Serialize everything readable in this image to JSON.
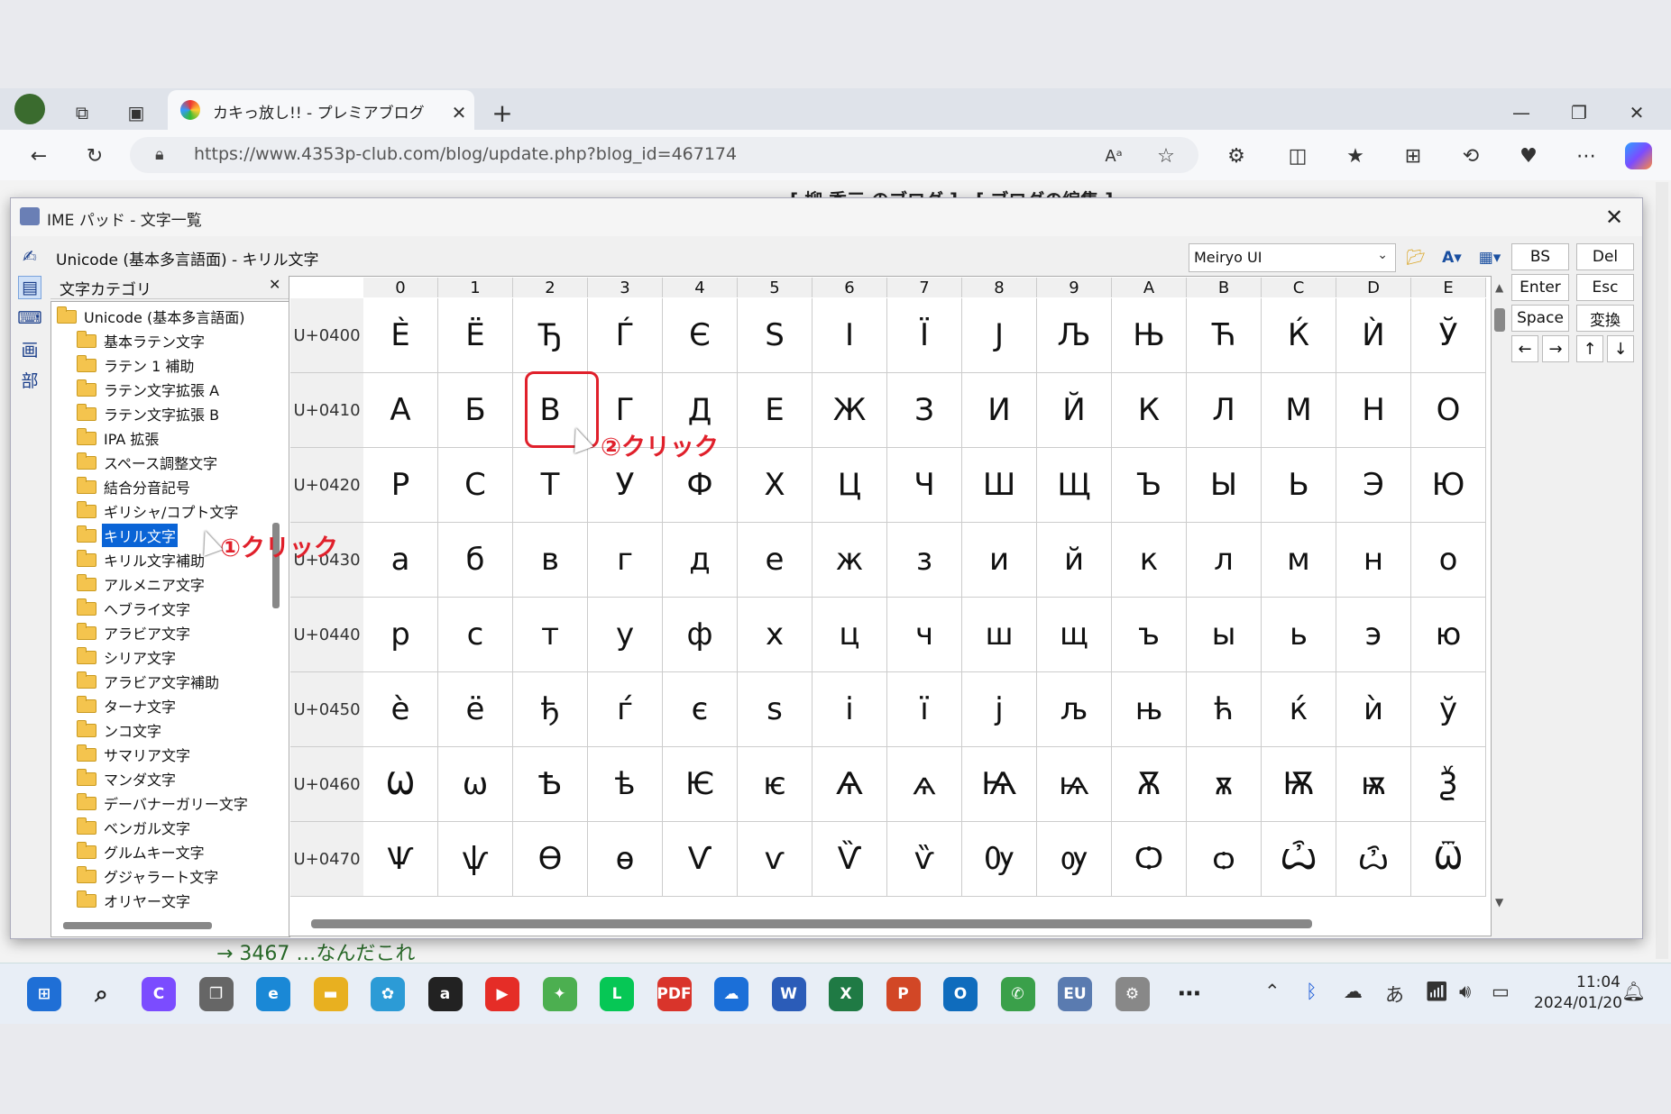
{
  "browser": {
    "tab_title": "カキっ放し!! - プレミアブログ",
    "url": "https://www.4353p-club.com/blog/update.php?blog_id=467174"
  },
  "background_page": {
    "header_text": "[ 柳 秀三 のブログ ]　[ ブログの編集 ]",
    "footer_text": "→ 3467 …なんだこれ"
  },
  "ime": {
    "title": "IME パッド - 文字一覧",
    "subtitle": "Unicode (基本多言語面) - キリル文字",
    "font": "Meiryo UI",
    "category_header": "文字カテゴリ",
    "left_tools": [
      "手書き",
      "文字一覧",
      "ソフトキーボード",
      "画",
      "部"
    ],
    "categories": [
      {
        "label": "Unicode (基本多言語面)",
        "level": 0
      },
      {
        "label": "基本ラテン文字",
        "level": 1
      },
      {
        "label": "ラテン 1 補助",
        "level": 1
      },
      {
        "label": "ラテン文字拡張 A",
        "level": 1
      },
      {
        "label": "ラテン文字拡張 B",
        "level": 1
      },
      {
        "label": "IPA 拡張",
        "level": 1
      },
      {
        "label": "スペース調整文字",
        "level": 1
      },
      {
        "label": "結合分音記号",
        "level": 1
      },
      {
        "label": "ギリシャ/コプト文字",
        "level": 1
      },
      {
        "label": "キリル文字",
        "level": 1,
        "selected": true
      },
      {
        "label": "キリル文字補助",
        "level": 1
      },
      {
        "label": "アルメニア文字",
        "level": 1
      },
      {
        "label": "ヘブライ文字",
        "level": 1
      },
      {
        "label": "アラビア文字",
        "level": 1
      },
      {
        "label": "シリア文字",
        "level": 1
      },
      {
        "label": "アラビア文字補助",
        "level": 1
      },
      {
        "label": "ターナ文字",
        "level": 1
      },
      {
        "label": "ンコ文字",
        "level": 1
      },
      {
        "label": "サマリア文字",
        "level": 1
      },
      {
        "label": "マンダ文字",
        "level": 1
      },
      {
        "label": "デーバナーガリー文字",
        "level": 1
      },
      {
        "label": "ベンガル文字",
        "level": 1
      },
      {
        "label": "グルムキー文字",
        "level": 1
      },
      {
        "label": "グジャラート文字",
        "level": 1
      },
      {
        "label": "オリヤー文字",
        "level": 1
      }
    ],
    "columns": [
      "0",
      "1",
      "2",
      "3",
      "4",
      "5",
      "6",
      "7",
      "8",
      "9",
      "A",
      "B",
      "C",
      "D",
      "E"
    ],
    "rows": [
      {
        "code": "U+0400",
        "chars": [
          "Ѐ",
          "Ё",
          "Ђ",
          "Ѓ",
          "Є",
          "Ѕ",
          "І",
          "Ї",
          "Ј",
          "Љ",
          "Њ",
          "Ћ",
          "Ќ",
          "Ѝ",
          "Ў"
        ]
      },
      {
        "code": "U+0410",
        "chars": [
          "А",
          "Б",
          "В",
          "Г",
          "Д",
          "Е",
          "Ж",
          "З",
          "И",
          "Й",
          "К",
          "Л",
          "М",
          "Н",
          "О"
        ]
      },
      {
        "code": "U+0420",
        "chars": [
          "Р",
          "С",
          "Т",
          "У",
          "Ф",
          "Х",
          "Ц",
          "Ч",
          "Ш",
          "Щ",
          "Ъ",
          "Ы",
          "Ь",
          "Э",
          "Ю"
        ]
      },
      {
        "code": "U+0430",
        "chars": [
          "а",
          "б",
          "в",
          "г",
          "д",
          "е",
          "ж",
          "з",
          "и",
          "й",
          "к",
          "л",
          "м",
          "н",
          "о"
        ]
      },
      {
        "code": "U+0440",
        "chars": [
          "р",
          "с",
          "т",
          "у",
          "ф",
          "х",
          "ц",
          "ч",
          "ш",
          "щ",
          "ъ",
          "ы",
          "ь",
          "э",
          "ю"
        ]
      },
      {
        "code": "U+0450",
        "chars": [
          "ѐ",
          "ё",
          "ђ",
          "ѓ",
          "є",
          "ѕ",
          "і",
          "ї",
          "ј",
          "љ",
          "њ",
          "ћ",
          "ќ",
          "ѝ",
          "ў"
        ]
      },
      {
        "code": "U+0460",
        "chars": [
          "Ѡ",
          "ѡ",
          "Ѣ",
          "ѣ",
          "Ѥ",
          "ѥ",
          "Ѧ",
          "ѧ",
          "Ѩ",
          "ѩ",
          "Ѫ",
          "ѫ",
          "Ѭ",
          "ѭ",
          "Ѯ"
        ]
      },
      {
        "code": "U+0470",
        "chars": [
          "Ѱ",
          "ѱ",
          "Ѳ",
          "ѳ",
          "Ѵ",
          "ѵ",
          "Ѷ",
          "ѷ",
          "Ѹ",
          "ѹ",
          "Ѻ",
          "ѻ",
          "Ѽ",
          "ѽ",
          "Ѿ"
        ]
      }
    ],
    "keys": {
      "bs": "BS",
      "del": "Del",
      "enter": "Enter",
      "esc": "Esc",
      "space": "Space",
      "convert": "変換",
      "left": "←",
      "right": "→",
      "up": "↑",
      "down": "↓"
    }
  },
  "annotations": {
    "step1": "①クリック",
    "step2": "②クリック"
  },
  "taskbar": {
    "time": "11:04",
    "date": "2024/01/20",
    "ime_mode": "あ",
    "apps": [
      "start",
      "search",
      "copilot",
      "task-view",
      "edge",
      "explorer",
      "paint",
      "amazon",
      "youtube",
      "blog",
      "line",
      "pdf",
      "onedrive",
      "word",
      "excel",
      "powerpoint",
      "outlook",
      "phone",
      "eu",
      "settings",
      "more"
    ]
  },
  "colors": {
    "accent": "#0a64d6",
    "annotation": "#e0202b"
  }
}
